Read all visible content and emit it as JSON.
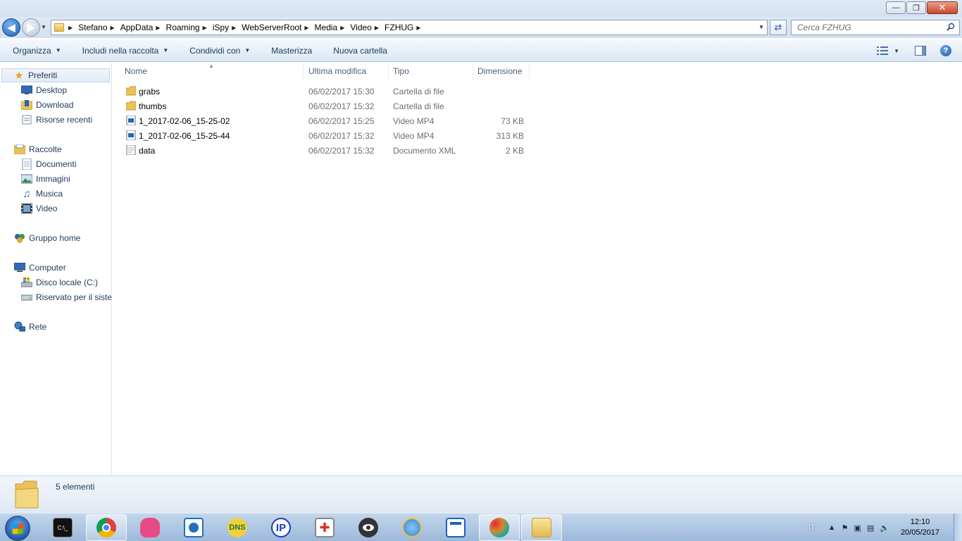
{
  "window": {
    "minimize_label": "—",
    "maximize_label": "❐",
    "close_label": "✕"
  },
  "address": {
    "breadcrumbs": [
      "Stefano",
      "AppData",
      "Roaming",
      "iSpy",
      "WebServerRoot",
      "Media",
      "Video",
      "FZHUG"
    ],
    "search_placeholder": "Cerca FZHUG"
  },
  "toolbar": {
    "organize": "Organizza",
    "include": "Includi nella raccolta",
    "share": "Condividi con",
    "burn": "Masterizza",
    "new_folder": "Nuova cartella"
  },
  "navigation": {
    "favorites": {
      "label": "Preferiti",
      "items": [
        "Desktop",
        "Download",
        "Risorse recenti"
      ]
    },
    "libraries": {
      "label": "Raccolte",
      "items": [
        "Documenti",
        "Immagini",
        "Musica",
        "Video"
      ]
    },
    "homegroup": "Gruppo home",
    "computer": {
      "label": "Computer",
      "items": [
        "Disco locale (C:)",
        "Riservato per il sistema"
      ]
    },
    "network": "Rete"
  },
  "columns": {
    "name": "Nome",
    "modified": "Ultima modifica",
    "type": "Tipo",
    "size": "Dimensione"
  },
  "files": [
    {
      "name": "grabs",
      "modified": "06/02/2017 15:30",
      "type": "Cartella di file",
      "size": "",
      "icon": "folder-icon"
    },
    {
      "name": "thumbs",
      "modified": "06/02/2017 15:32",
      "type": "Cartella di file",
      "size": "",
      "icon": "folder-icon"
    },
    {
      "name": "1_2017-02-06_15-25-02",
      "modified": "06/02/2017 15:25",
      "type": "Video MP4",
      "size": "73 KB",
      "icon": "video-file-icon"
    },
    {
      "name": "1_2017-02-06_15-25-44",
      "modified": "06/02/2017 15:32",
      "type": "Video MP4",
      "size": "313 KB",
      "icon": "video-file-icon"
    },
    {
      "name": "data",
      "modified": "06/02/2017 15:32",
      "type": "Documento XML",
      "size": "2 KB",
      "icon": "xml-file-icon"
    }
  ],
  "status": {
    "count": "5 elementi"
  },
  "taskbar": {
    "apps": [
      {
        "name": "cmd-icon",
        "label": "C:\\_",
        "color": "#111111"
      },
      {
        "name": "chrome-icon",
        "label": "",
        "color": "#2a7de1"
      },
      {
        "name": "pink-bag-icon",
        "label": "",
        "color": "#e84a86"
      },
      {
        "name": "network-monitor-icon",
        "label": "",
        "color": "#1f6fbf"
      },
      {
        "name": "dns-icon",
        "label": "DNS",
        "color": "#1d7a2b"
      },
      {
        "name": "ip-icon",
        "label": "IP",
        "color": "#1f3fb8"
      },
      {
        "name": "security-icon",
        "label": "",
        "color": "#d9322b"
      },
      {
        "name": "eye-icon",
        "label": "",
        "color": "#333333"
      },
      {
        "name": "globe-icon",
        "label": "",
        "color": "#2f86d6"
      },
      {
        "name": "app-window-icon",
        "label": "",
        "color": "#1b62b5"
      },
      {
        "name": "paint-icon",
        "label": "",
        "color": "#d58a2a"
      },
      {
        "name": "explorer-icon",
        "label": "",
        "color": "#e2b84d"
      }
    ],
    "language": "IT",
    "time": "12:10",
    "date": "20/05/2017"
  }
}
